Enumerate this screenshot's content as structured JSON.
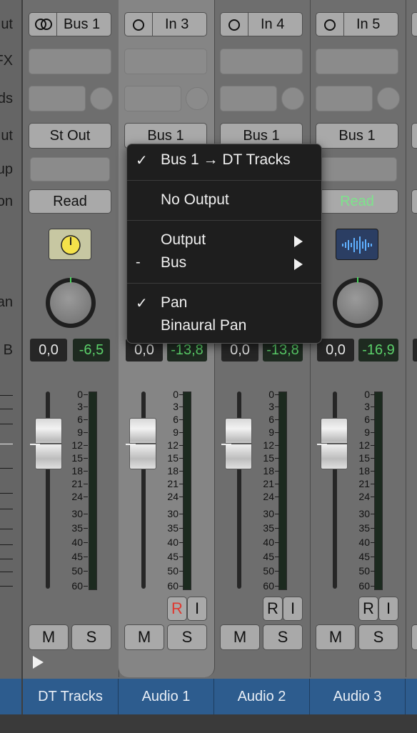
{
  "labels": [
    "ut",
    "FX",
    "ds",
    "ut",
    "up",
    "on",
    "an",
    "B"
  ],
  "strips": [
    {
      "input_label": "Bus 1",
      "input_icon": "stereo-link-icon",
      "output": "St Out",
      "automation": "Read",
      "automation_color": "#111111",
      "pan_value": "0,0",
      "volume_value": "-6,5",
      "mute": "M",
      "solo": "S",
      "record": "",
      "input_monitor": "",
      "plugin_icon": "tuner-icon",
      "name": "DT Tracks"
    },
    {
      "input_label": "In 3",
      "input_icon": "mono-input-icon",
      "output": "Bus 1",
      "automation": "",
      "pan_value": "0,0",
      "volume_value": "-13,8",
      "mute": "M",
      "solo": "S",
      "record": "R",
      "input_monitor": "I",
      "name": "Audio 1"
    },
    {
      "input_label": "In 4",
      "input_icon": "mono-input-icon",
      "output": "Bus 1",
      "automation": "",
      "pan_value": "0,0",
      "volume_value": "-13,8",
      "mute": "M",
      "solo": "S",
      "record": "R",
      "input_monitor": "I",
      "name": "Audio 2"
    },
    {
      "input_label": "In 5",
      "input_icon": "mono-input-icon",
      "output": "Bus 1",
      "automation": "Read",
      "automation_color": "#7de38b",
      "pan_value": "0,0",
      "volume_value": "-16,9",
      "mute": "M",
      "solo": "S",
      "record": "R",
      "input_monitor": "I",
      "plugin_icon": "waveform-icon",
      "name": "Audio 3"
    }
  ],
  "scale": [
    "0",
    "3",
    "6",
    "9",
    "12",
    "15",
    "18",
    "21",
    "24",
    "30",
    "35",
    "40",
    "45",
    "50",
    "60"
  ],
  "menu": {
    "item1": {
      "check": "✓",
      "label": "Bus 1 → DT Tracks"
    },
    "item2": {
      "label": "No Output"
    },
    "item3": {
      "label": "Output"
    },
    "item4": {
      "check": "-",
      "label": "Bus"
    },
    "item5": {
      "check": "✓",
      "label": "Pan"
    },
    "item6": {
      "label": "Binaural Pan"
    }
  },
  "colors": {
    "record_active": "#e0382f",
    "name_bar": "#2d5c8e",
    "meter_value": "#5bd16a"
  }
}
